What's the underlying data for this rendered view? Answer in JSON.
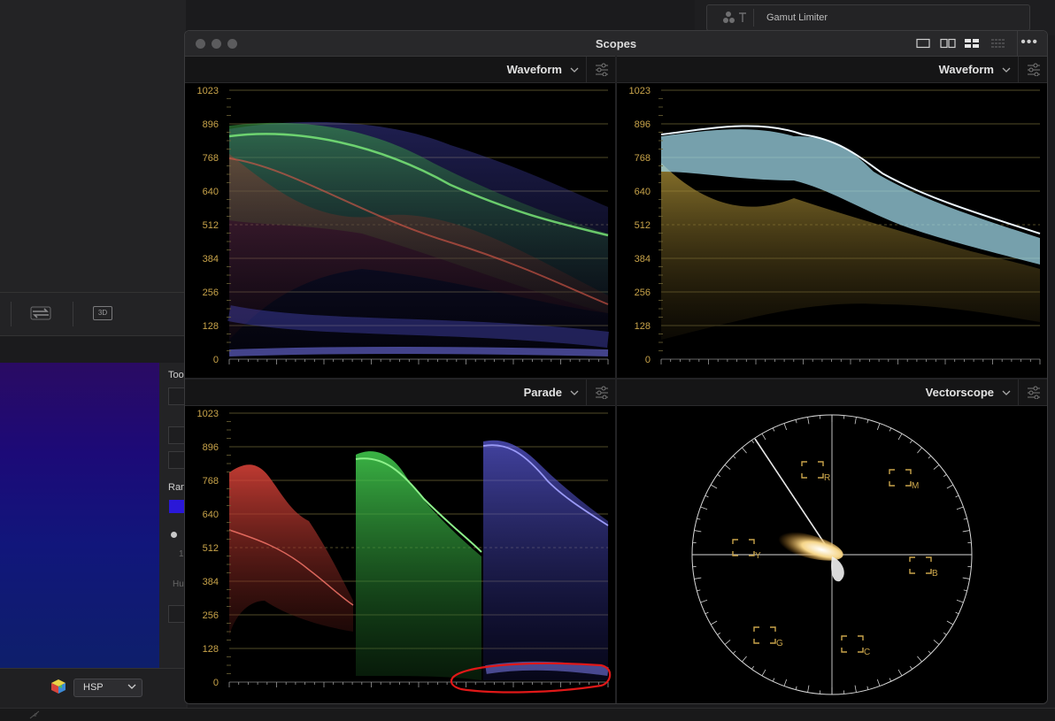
{
  "background_panel": {
    "gamut_limiter_label": "Gamut Limiter",
    "tools_partial": "Too",
    "range_partial": "Ran",
    "hue_partial": "Hu",
    "one_partial": "1",
    "colorspace_select": "HSP",
    "toolbar_3d_label": "3D"
  },
  "window": {
    "title": "Scopes",
    "more_label": "•••"
  },
  "panes": {
    "top_left": {
      "scope": "Waveform",
      "axis_labels": [
        "1023",
        "896",
        "768",
        "640",
        "512",
        "384",
        "256",
        "128",
        "0"
      ]
    },
    "top_right": {
      "scope": "Waveform",
      "axis_labels": [
        "1023",
        "896",
        "768",
        "640",
        "512",
        "384",
        "256",
        "128",
        "0"
      ]
    },
    "bottom_left": {
      "scope": "Parade",
      "axis_labels": [
        "1023",
        "896",
        "768",
        "640",
        "512",
        "384",
        "256",
        "128",
        "0"
      ]
    },
    "bottom_right": {
      "scope": "Vectorscope",
      "targets": [
        "R",
        "M",
        "Y",
        "B",
        "G",
        "C"
      ]
    }
  },
  "colors": {
    "axis_label": "#c9a44a",
    "gridline": "#6e6437",
    "red_channel": "#e0433a",
    "green_channel": "#3fd04a",
    "blue_channel": "#5a5ae8",
    "luma": "#c8e8f8",
    "annotation": "#e01818"
  },
  "annotation": {
    "shape": "red hand-drawn ellipse around bottom of blue parade channel"
  }
}
